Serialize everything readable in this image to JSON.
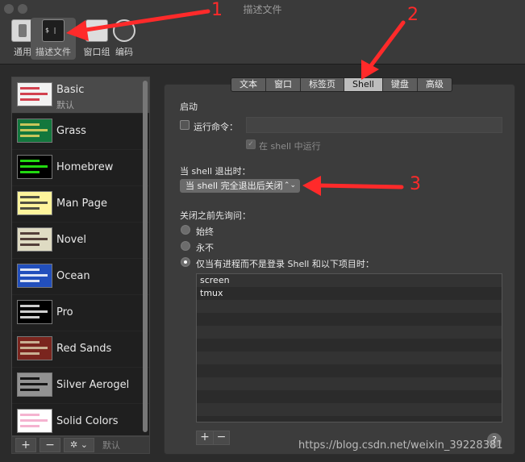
{
  "window": {
    "title": "描述文件"
  },
  "toolbar": [
    {
      "label": "通用",
      "icon": "switch-icon"
    },
    {
      "label": "描述文件",
      "icon": "terminal-profile-icon"
    },
    {
      "label": "窗口组",
      "icon": "window-group-icon"
    },
    {
      "label": "编码",
      "icon": "globe-icon"
    }
  ],
  "profiles": [
    {
      "name": "Basic",
      "sub": "默认",
      "thumb_bg": "#f2f2f2",
      "thumb_accent": "#c23"
    },
    {
      "name": "Grass",
      "thumb_bg": "#13773d",
      "thumb_accent": "#e8d35f"
    },
    {
      "name": "Homebrew",
      "thumb_bg": "#000000",
      "thumb_accent": "#28fe14"
    },
    {
      "name": "Man Page",
      "thumb_bg": "#fef49c",
      "thumb_accent": "#333"
    },
    {
      "name": "Novel",
      "thumb_bg": "#dfdbc3",
      "thumb_accent": "#3b2322"
    },
    {
      "name": "Ocean",
      "thumb_bg": "#224fbc",
      "thumb_accent": "#ffffff"
    },
    {
      "name": "Pro",
      "thumb_bg": "#000000",
      "thumb_accent": "#f2f2f2"
    },
    {
      "name": "Red Sands",
      "thumb_bg": "#7a251e",
      "thumb_accent": "#d7c9a7"
    },
    {
      "name": "Silver Aerogel",
      "thumb_bg": "#929292",
      "thumb_accent": "#000"
    },
    {
      "name": "Solid Colors",
      "thumb_bg": "#ffffff",
      "thumb_accent": "#f3a6c8"
    }
  ],
  "sidebar_footer": {
    "add": "+",
    "remove": "−",
    "gear": "✲",
    "gear_chevron": "⌄",
    "default": "默认"
  },
  "tabs": [
    "文本",
    "窗口",
    "标签页",
    "Shell",
    "键盘",
    "高级"
  ],
  "active_tab": "Shell",
  "startup": {
    "heading": "启动",
    "run_command_label": "运行命令：",
    "run_in_shell_label": "在 shell 中运行"
  },
  "on_exit": {
    "heading": "当 shell 退出时：",
    "selected": "当 shell 完全退出后关闭"
  },
  "ask_before_close": {
    "heading": "关闭之前先询问：",
    "options": [
      "始终",
      "永不",
      "仅当有进程而不是登录 Shell 和以下项目时："
    ],
    "selected_index": 2
  },
  "processes": [
    "screen",
    "tmux"
  ],
  "list_buttons": {
    "add": "+",
    "remove": "−"
  },
  "help": "?",
  "annotations": [
    "1",
    "2",
    "3"
  ],
  "colors": {
    "arrow": "#ff2a2a"
  },
  "watermark": "https://blog.csdn.net/weixin_39228381"
}
